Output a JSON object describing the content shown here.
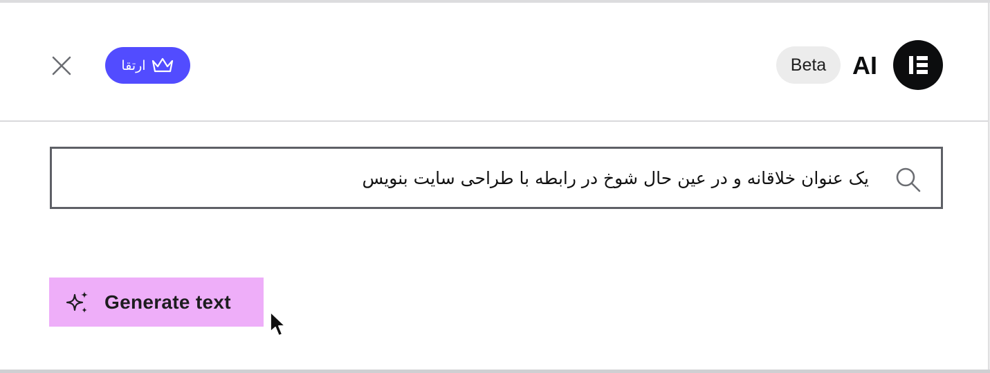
{
  "header": {
    "close_icon": "close-icon",
    "upgrade_label": "ارتقا",
    "upgrade_icon": "crown-icon",
    "beta_label": "Beta",
    "ai_title": "AI",
    "logo_icon": "elementor-logo-icon"
  },
  "prompt": {
    "search_icon": "search-icon",
    "value": "یک عنوان خلاقانه و در عین حال شوخ در رابطه با طراحی سایت بنویس"
  },
  "actions": {
    "generate_label": "Generate text",
    "generate_icon": "sparkles-icon"
  },
  "colors": {
    "upgrade_bg": "#524cff",
    "generate_bg": "#eeaef9",
    "logo_bg": "#0c0d0e",
    "input_border": "#5e6066"
  }
}
